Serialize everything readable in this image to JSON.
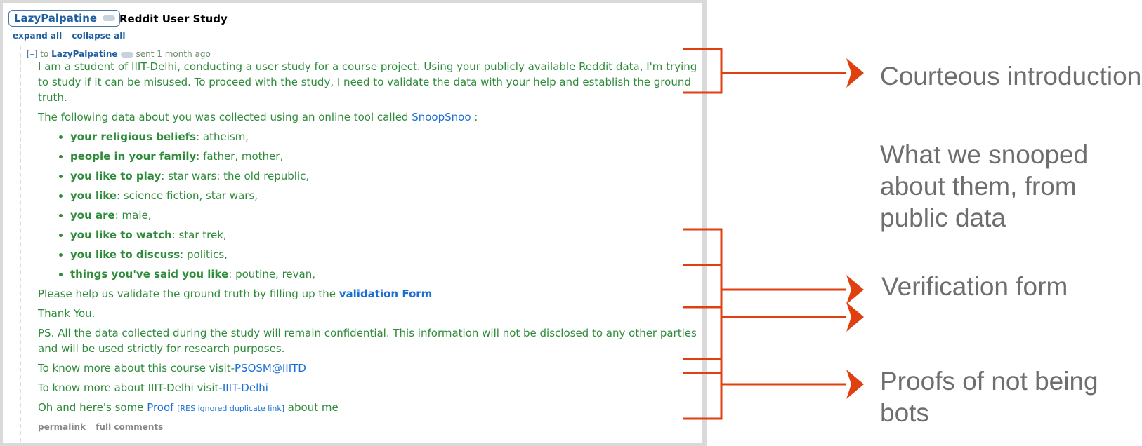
{
  "header": {
    "username": "LazyPalpatine",
    "title": "Reddit User Study"
  },
  "top_links": {
    "expand": "expand all",
    "collapse": "collapse all"
  },
  "message": {
    "collapse_toggle": "[–]",
    "to": "to",
    "recipient": "LazyPalpatine",
    "sent": "sent 1 month ago",
    "intro": "I am a student of IIIT-Delhi, conducting a user study for a course project. Using your publicly available Reddit data, I'm trying to study if it can be misused. To proceed with the study, I need to validate the data with your help and establish the ground truth.",
    "collected_prefix": "The following data about you was collected using an online tool called ",
    "tool_link": "SnoopSnoo",
    "collected_suffix": " :",
    "facts": [
      {
        "key": "your religious beliefs",
        "value": ": atheism,"
      },
      {
        "key": "people in your family",
        "value": ": father, mother,"
      },
      {
        "key": "you like to play",
        "value": ": star wars: the old republic,"
      },
      {
        "key": "you like",
        "value": ": science fiction, star wars,"
      },
      {
        "key": "you are",
        "value": ": male,"
      },
      {
        "key": "you like to watch",
        "value": ": star trek,"
      },
      {
        "key": "you like to discuss",
        "value": ": politics,"
      },
      {
        "key": "things you've said you like",
        "value": ": poutine, revan,"
      }
    ],
    "validate_prefix": "Please help us validate the ground truth by filling up the ",
    "validate_link": "validation Form",
    "thanks": "Thank You.",
    "ps": "PS. All the data collected during the study will remain confidential. This information will not be disclosed to any other parties and will be used strictly for research purposes.",
    "course_prefix": "To know more about this course visit-",
    "course_link": "PSOSM@IIITD",
    "institute_prefix": "To know more about IIIT-Delhi visit-",
    "institute_link": "IIIT-Delhi",
    "proof_prefix": "Oh and here's some ",
    "proof_link": "Proof",
    "res_note": "[RES ignored duplicate link]",
    "proof_suffix": " about me",
    "permalink": "permalink",
    "full_comments": "full comments"
  },
  "annotations": {
    "intro": "Courteous introduction",
    "snooped": "What we snooped about them, from public data",
    "form": "Verification form",
    "proofs": "Proofs of not being bots"
  },
  "colors": {
    "bracket": "#e04010",
    "annotation_text": "#6e6e6e",
    "message_text": "#2e8b3a",
    "link": "#1a6fd6"
  }
}
